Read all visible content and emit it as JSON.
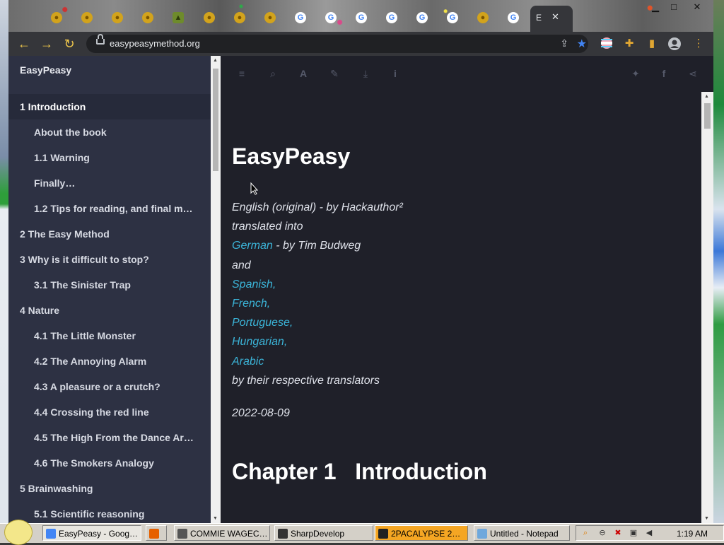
{
  "browser": {
    "active_tab_label": "E",
    "active_tab_close": "✕",
    "tab_favicons": [
      {
        "kind": "yellow",
        "glyph": "●"
      },
      {
        "kind": "yellow",
        "glyph": "●"
      },
      {
        "kind": "yellow",
        "glyph": "●"
      },
      {
        "kind": "yellow",
        "glyph": "●"
      },
      {
        "kind": "green",
        "glyph": "▲"
      },
      {
        "kind": "yellow",
        "glyph": "●"
      },
      {
        "kind": "yellow",
        "glyph": "●"
      },
      {
        "kind": "yellow",
        "glyph": "●"
      },
      {
        "kind": "google",
        "glyph": "G"
      },
      {
        "kind": "google",
        "glyph": "G"
      },
      {
        "kind": "google",
        "glyph": "G"
      },
      {
        "kind": "google",
        "glyph": "G"
      },
      {
        "kind": "google",
        "glyph": "G"
      },
      {
        "kind": "google",
        "glyph": "G"
      },
      {
        "kind": "yellow",
        "glyph": "●"
      },
      {
        "kind": "google",
        "glyph": "G"
      }
    ],
    "url": "easypeasymethod.org",
    "window_controls": {
      "minimize": "▁",
      "maximize": "□",
      "close": "✕"
    },
    "nav": {
      "back": "←",
      "forward": "→",
      "reload": "↻"
    }
  },
  "sidebar": {
    "title": "EasyPeasy",
    "items": [
      {
        "label": "1 Introduction",
        "level": 1,
        "active": true
      },
      {
        "label": "About the book",
        "level": 2
      },
      {
        "label": "1.1 Warning",
        "level": 2
      },
      {
        "label": "Finally…",
        "level": 2
      },
      {
        "label": "1.2 Tips for reading, and final m…",
        "level": 2
      },
      {
        "label": "2 The Easy Method",
        "level": 1
      },
      {
        "label": "3 Why is it difficult to stop?",
        "level": 1
      },
      {
        "label": "3.1 The Sinister Trap",
        "level": 2
      },
      {
        "label": "4 Nature",
        "level": 1
      },
      {
        "label": "4.1 The Little Monster",
        "level": 2
      },
      {
        "label": "4.2 The Annoying Alarm",
        "level": 2
      },
      {
        "label": "4.3 A pleasure or a crutch?",
        "level": 2
      },
      {
        "label": "4.4 Crossing the red line",
        "level": 2
      },
      {
        "label": "4.5 The High From the Dance Ar…",
        "level": 2
      },
      {
        "label": "4.6 The Smokers Analogy",
        "level": 2
      },
      {
        "label": "5 Brainwashing",
        "level": 1
      },
      {
        "label": "5.1 Scientific reasoning",
        "level": 2
      }
    ]
  },
  "content_toolbar": {
    "left_icons": [
      "menu-icon",
      "search-icon",
      "font-icon",
      "edit-icon",
      "download-icon",
      "info-icon"
    ],
    "right_icons": [
      "twitter-icon",
      "facebook-icon",
      "share-icon"
    ]
  },
  "main": {
    "title": "EasyPeasy",
    "author_line": "English (original) - by Hackauthor²",
    "translated_into": "translated into",
    "german": "German",
    "german_by": " - by Tim Budweg",
    "and": "and",
    "languages": [
      "Spanish",
      "French",
      "Portuguese",
      "Hungarian",
      "Arabic"
    ],
    "translators": "by their respective translators",
    "date": "2022-08-09",
    "chapter": "Chapter 1   Introduction"
  },
  "taskbar": {
    "tasks": [
      {
        "label": "EasyPeasy - Goog…",
        "pressed": true,
        "icon_color": "#4285f4"
      },
      {
        "label": "",
        "pressed": false,
        "icon_color": "#e66000"
      },
      {
        "label": "COMMIE WAGEC…",
        "pressed": false,
        "icon_color": "#555555"
      },
      {
        "label": "SharpDevelop",
        "pressed": false,
        "icon_color": "#333333"
      },
      {
        "label": "2PACALYPSE 2…",
        "pressed": false,
        "orange": true,
        "icon_color": "#222222"
      },
      {
        "label": "Untitled - Notepad",
        "pressed": false,
        "icon_color": "#6fa8dc"
      }
    ],
    "clock": "1:19 AM"
  }
}
